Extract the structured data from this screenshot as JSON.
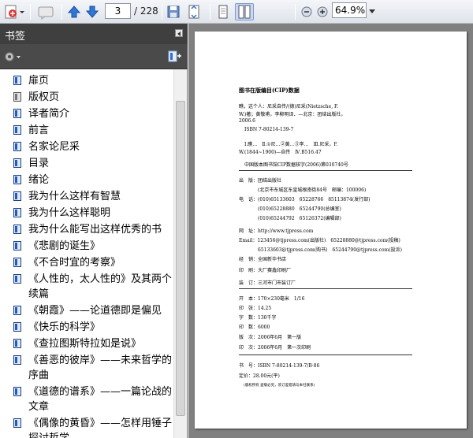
{
  "toolbar": {
    "current_page": "3",
    "total_pages": "/ 228",
    "zoom": "64.9%"
  },
  "panel": {
    "title": "书签",
    "items": [
      {
        "label": "扉页"
      },
      {
        "label": "版权页"
      },
      {
        "label": "译者简介"
      },
      {
        "label": "前言"
      },
      {
        "label": "名家论尼采"
      },
      {
        "label": "目录"
      },
      {
        "label": "绪论"
      },
      {
        "label": "我为什么这样有智慧"
      },
      {
        "label": "我为什么这样聪明"
      },
      {
        "label": "我为什么能写出这样优秀的书"
      },
      {
        "label": "《悲剧的诞生》"
      },
      {
        "label": "《不合时宜的考察》"
      },
      {
        "label": "《人性的，太人性的》及其两个续篇"
      },
      {
        "label": "《朝霞》——论道德即是偏见"
      },
      {
        "label": "《快乐的科学》"
      },
      {
        "label": "《查拉图斯特拉如是说》"
      },
      {
        "label": "《善恶的彼岸》——未来哲学的序曲"
      },
      {
        "label": "《道德的谱系》——一篇论战的文章"
      },
      {
        "label": "《偶像的黄昏》——怎样用锤子探讨哲学"
      }
    ]
  },
  "document": {
    "heading": "图书在版编目(CIP)数据",
    "cip_lines": [
      "瞧，这个人：尼采自传/(德)尼采(Nietzsche, F.",
      "W.)著；黄敬甫，李柳明译．—北京：团结出版社，",
      "2006.6",
      "ISBN 7-80214-139-7",
      "Ⅰ.瞧…　Ⅱ.①尼…②黄…③李…　Ⅲ.尼采，F.",
      "W.(1844~1900)—自传　Ⅳ.B516.47"
    ],
    "cip_note": "中国版本图书馆CIP数据核字(2006)第030740号",
    "publisher_lines": [
      "出　版：团结出版社",
      "　　　　(北京市东城区东皇城根南街84号　邮编：100006)",
      "电　话：(010)65133603　65228766　85113874(发行部)",
      "　　　　(010)65228880　65244790(总编室)",
      "　　　　(010)65244792　65126372(编辑部)",
      "网　址：http://www.tjpress.com",
      "Email：123456@tjpress.com(出版社)　65228880@tjpress.com(投稿)",
      "　　　　65133603@tjpress.com(购书)　65244790@tjpress.com(投诉)",
      "经　销：全国新华书店",
      "印　刷：大厂赛鑫印刷厂",
      "装　订：三河市门市装订厂"
    ],
    "spec_lines": [
      "开　本：170×230毫米　1/16",
      "印　张：14.25",
      "字　数：130千字",
      "印　数：6000",
      "版　次：2006年6月　第一版",
      "印　次：2006年6月　第一次印刷"
    ],
    "isbn_line": "书　号：ISBN 7-80214-139-7/B·86",
    "price_line": "定价：28.00元(平)",
    "footer_note": "(版权所有 盗版必究，装订差错请与本社联系)"
  }
}
